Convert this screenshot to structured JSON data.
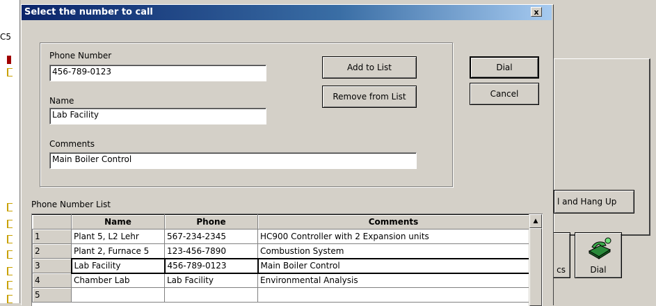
{
  "background": {
    "left_fragment": "C5",
    "hang_up_label": "l and Hang Up",
    "tile_left_label": "cs",
    "tile_dial_label": "Dial"
  },
  "dialog": {
    "title": "Select the number to call",
    "close_glyph": "x",
    "phone_number_label": "Phone Number",
    "phone_number_value": "456-789-0123",
    "name_label": "Name",
    "name_value": "Lab Facility",
    "comments_label": "Comments",
    "comments_value": "Main Boiler Control",
    "add_to_list": "Add to List",
    "remove_from_list": "Remove from List",
    "dial": "Dial",
    "cancel": "Cancel",
    "list_label": "Phone Number List"
  },
  "grid": {
    "columns": [
      "Name",
      "Phone",
      "Comments"
    ],
    "rows": [
      {
        "num": "1",
        "name": "Plant 5, L2 Lehr",
        "phone": "567-234-2345",
        "comments": "HC900 Controller with 2 Expansion units"
      },
      {
        "num": "2",
        "name": "Plant 2, Furnace 5",
        "phone": "123-456-7890",
        "comments": "Combustion System"
      },
      {
        "num": "3",
        "name": "Lab Facility",
        "phone": "456-789-0123",
        "comments": "Main Boiler Control"
      },
      {
        "num": "4",
        "name": "Chamber Lab",
        "phone": "Lab Facility",
        "comments": "Environmental Analysis"
      },
      {
        "num": "5",
        "name": "",
        "phone": "",
        "comments": ""
      }
    ],
    "selected_row": 3,
    "scroll_up_glyph": "▲"
  }
}
